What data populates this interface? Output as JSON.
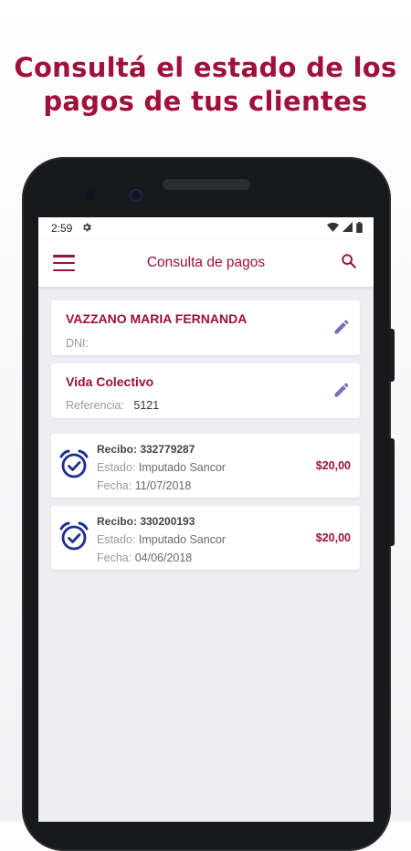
{
  "headline": {
    "line1": "Consultá el estado de los",
    "line2": "pagos de tus clientes"
  },
  "colors": {
    "brand": "#9b1139",
    "icon_blue": "#1d2f8f",
    "edit_purple": "#7a6fb3"
  },
  "statusbar": {
    "time": "2:59",
    "icons": [
      "gear-icon",
      "wifi-icon",
      "signal-icon",
      "battery-icon"
    ]
  },
  "appbar": {
    "title": "Consulta de pagos",
    "menu_icon": "hamburger-icon",
    "search_icon": "search-icon"
  },
  "client": {
    "name": "VAZZANO MARIA FERNANDA",
    "dni_label": "DNI:",
    "dni_value": ""
  },
  "product": {
    "name": "Vida Colectivo",
    "ref_label": "Referencia:",
    "ref_value": "5121"
  },
  "receipts": [
    {
      "title": "Recibo: 332779287",
      "estado_label": "Estado:",
      "estado_value": "Imputado Sancor",
      "fecha_label": "Fecha:",
      "fecha_value": "11/07/2018",
      "amount": "$20,00"
    },
    {
      "title": "Recibo: 330200193",
      "estado_label": "Estado:",
      "estado_value": "Imputado Sancor",
      "fecha_label": "Fecha:",
      "fecha_value": "04/06/2018",
      "amount": "$20,00"
    }
  ]
}
